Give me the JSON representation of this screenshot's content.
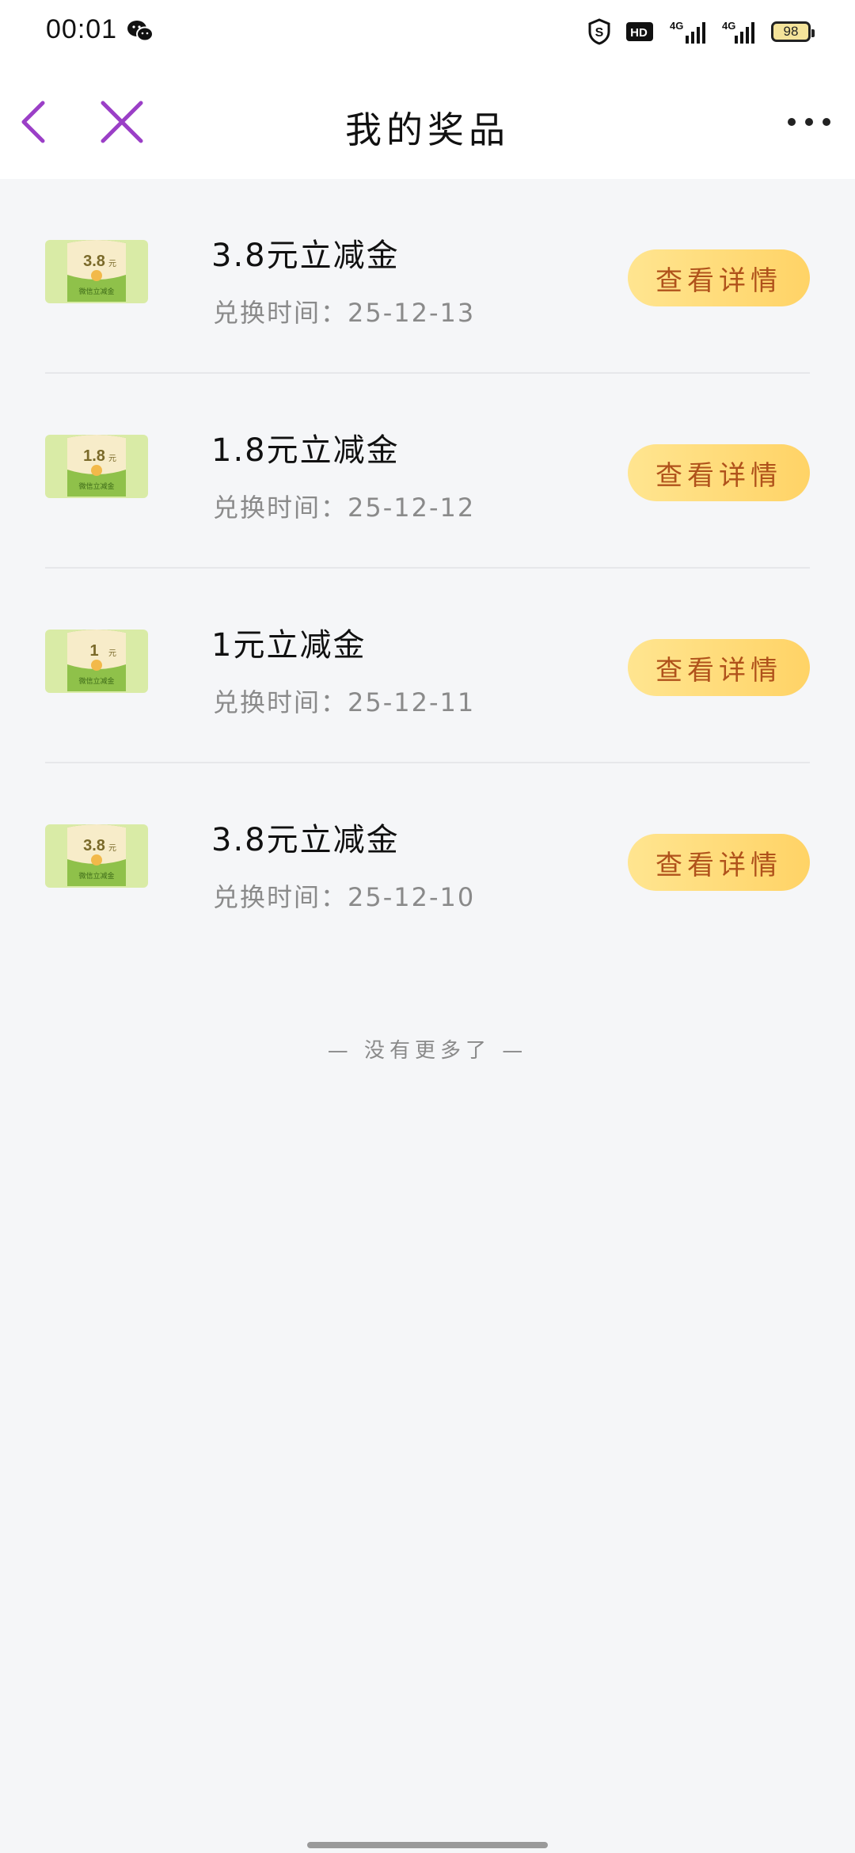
{
  "status_bar": {
    "time": "00:01",
    "battery": "98",
    "hd_label": "HD",
    "signal_1_label": "4G",
    "signal_2_label": "4G"
  },
  "nav": {
    "title": "我的奖品"
  },
  "prizes": [
    {
      "thumb_amount": "3.8",
      "thumb_unit": "元",
      "thumb_caption": "微信立减金",
      "title": "3.8元立减金",
      "time": "兑换时间：25-12-13",
      "button": "查看详情"
    },
    {
      "thumb_amount": "1.8",
      "thumb_unit": "元",
      "thumb_caption": "微信立减金",
      "title": "1.8元立减金",
      "time": "兑换时间：25-12-12",
      "button": "查看详情"
    },
    {
      "thumb_amount": "1",
      "thumb_unit": "元",
      "thumb_caption": "微信立减金",
      "title": "1元立减金",
      "time": "兑换时间：25-12-11",
      "button": "查看详情"
    },
    {
      "thumb_amount": "3.8",
      "thumb_unit": "元",
      "thumb_caption": "微信立减金",
      "title": "3.8元立减金",
      "time": "兑换时间：25-12-10",
      "button": "查看详情"
    }
  ],
  "footer": {
    "no_more": "— 没有更多了 —"
  },
  "colors": {
    "accent_purple": "#9b3fc7",
    "button_start": "#ffe590",
    "button_end": "#ffd366",
    "button_text": "#b0521b"
  }
}
